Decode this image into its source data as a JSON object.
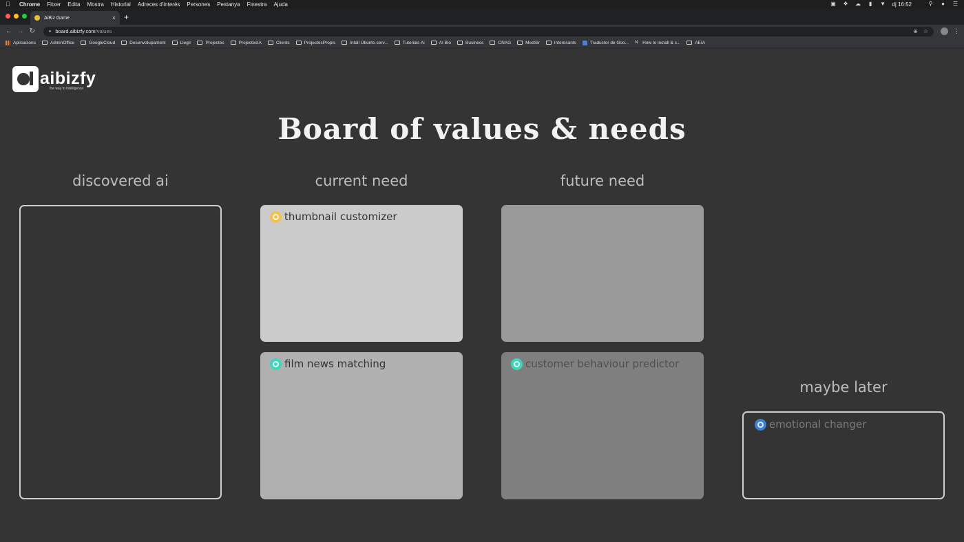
{
  "menubar": {
    "app": "Chrome",
    "items": [
      "Fitxer",
      "Edita",
      "Mostra",
      "Historial",
      "Adreces d'interès",
      "Persones",
      "Pestanya",
      "Finestra",
      "Ajuda"
    ],
    "clock": "dj 16:52"
  },
  "browser": {
    "tab_title": "AiBiz Game",
    "url_host": "board.aibizfy.com",
    "url_path": "/values",
    "bookmarks": [
      {
        "label": "Aplicacions",
        "icon": "apps-grid-icon"
      },
      {
        "label": "AdminOffice",
        "icon": "folder-icon"
      },
      {
        "label": "GoogleCloud",
        "icon": "folder-icon"
      },
      {
        "label": "Desenvolupament",
        "icon": "folder-icon"
      },
      {
        "label": "Llegir",
        "icon": "folder-icon"
      },
      {
        "label": "Projectes",
        "icon": "folder-icon"
      },
      {
        "label": "ProjectesIA",
        "icon": "folder-icon"
      },
      {
        "label": "Clients",
        "icon": "folder-icon"
      },
      {
        "label": "ProjectesPropis",
        "icon": "folder-icon"
      },
      {
        "label": "Intall Ubunto serv...",
        "icon": "folder-icon"
      },
      {
        "label": "Tutorials Ai",
        "icon": "folder-icon"
      },
      {
        "label": "AI Bio",
        "icon": "folder-icon"
      },
      {
        "label": "Business",
        "icon": "folder-icon"
      },
      {
        "label": "CNAG",
        "icon": "folder-icon"
      },
      {
        "label": "MedSir",
        "icon": "folder-icon"
      },
      {
        "label": "Interesants",
        "icon": "folder-icon"
      },
      {
        "label": "Traductor de Goo...",
        "icon": "translate-icon"
      },
      {
        "label": "How to install & s...",
        "icon": "site-icon"
      },
      {
        "label": "AEIA",
        "icon": "folder-icon"
      }
    ]
  },
  "page": {
    "logo": {
      "brand": "aibizfy",
      "tagline": "the way to intelligence"
    },
    "title": "Board of values & needs",
    "columns": {
      "discovered": "discovered ai",
      "current": "current need",
      "future": "future need",
      "later": "maybe later"
    },
    "cards": {
      "current_top": {
        "label": "thumbnail customizer",
        "icon_color": "#f2c14e",
        "bg": "#cbcbcb",
        "text_color": "#333333"
      },
      "current_bottom": {
        "label": "film news matching",
        "icon_color": "#3fd7b5",
        "bg": "#b0b0b0",
        "text_color": "#333333"
      },
      "future_top": {
        "label": "",
        "bg": "#9a9a9a"
      },
      "future_bottom": {
        "label": "customer behaviour predictor",
        "icon_color": "#3fd7b5",
        "bg": "#7f7f7f",
        "text_color": "#4f4f4f"
      },
      "later": {
        "label": "emotional changer",
        "icon_color": "#3d7fd1",
        "text_color": "#7a7a7a"
      }
    }
  }
}
